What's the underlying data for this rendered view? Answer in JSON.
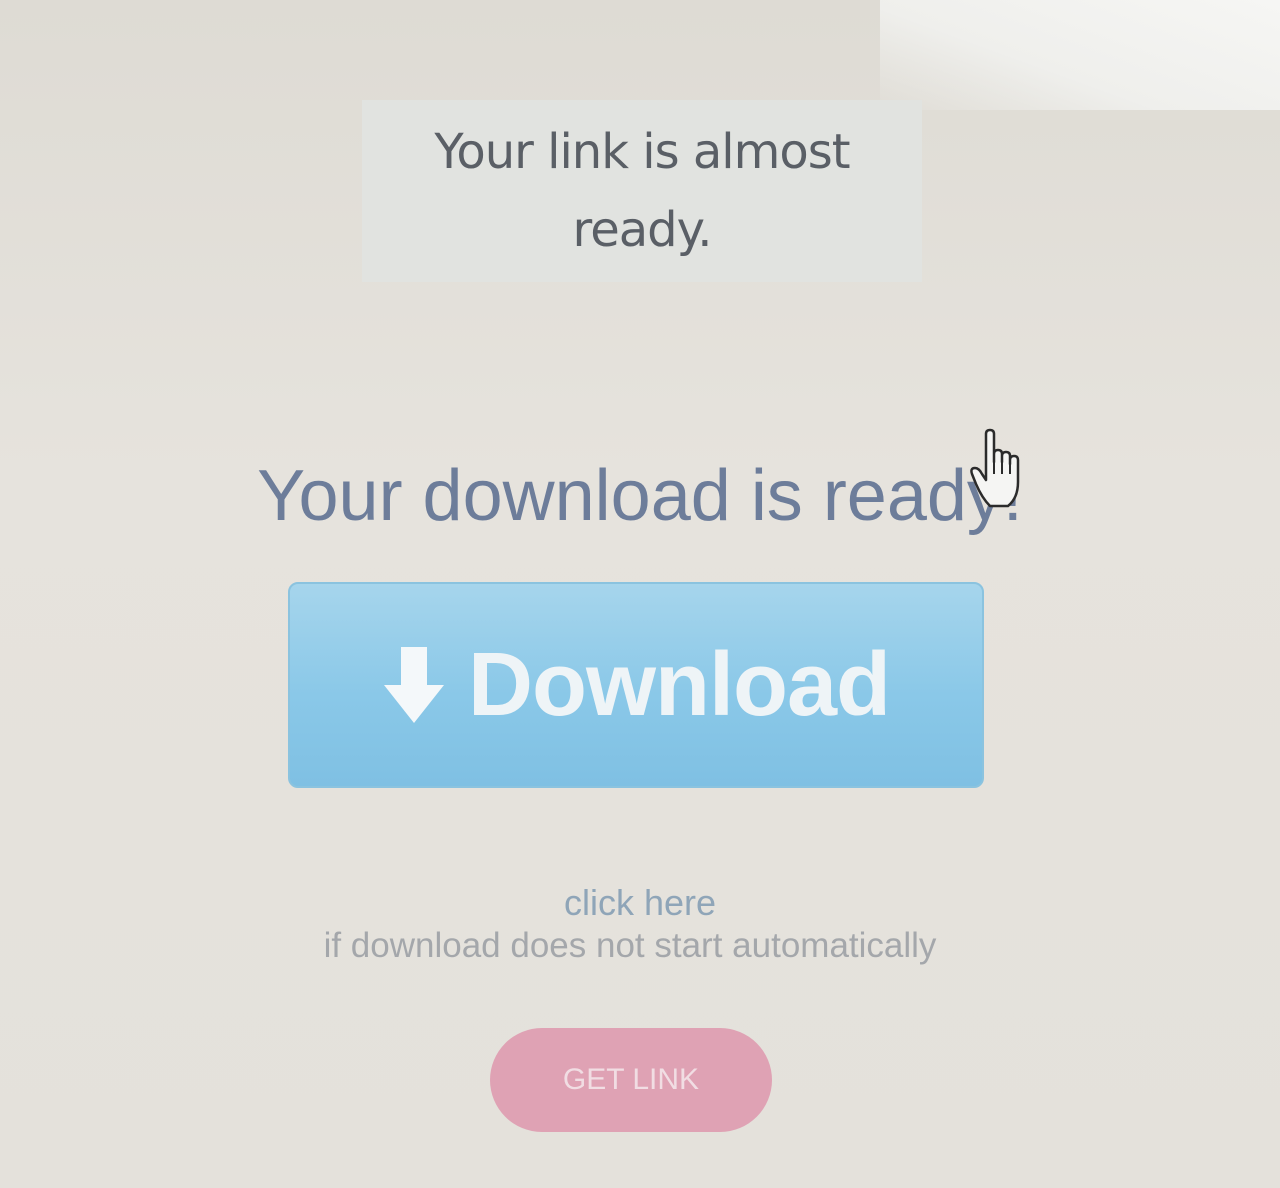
{
  "header": {
    "almost_ready_text": "Your link is almost ready."
  },
  "main": {
    "heading": "Your download is ready!",
    "download_button_label": "Download",
    "download_icon": "arrow-down-icon",
    "click_here_link": "click here",
    "auto_download_note": "if download does not start automatically",
    "get_link_button_label": "GET LINK"
  },
  "cursor": {
    "icon": "hand-pointer-icon"
  },
  "colors": {
    "download_button": "#8ac8e8",
    "get_link_button": "#dfa2b4",
    "heading_text": "#6d7d9a"
  }
}
